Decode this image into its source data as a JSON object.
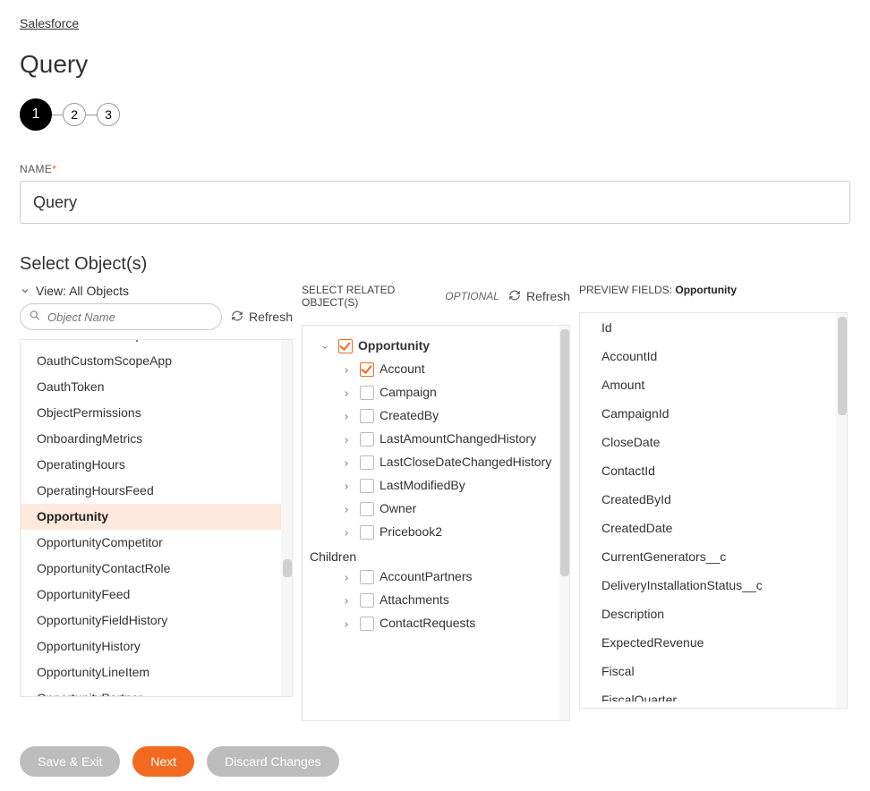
{
  "breadcrumb": "Salesforce",
  "title": "Query",
  "stepper": {
    "current": 1,
    "steps": [
      "1",
      "2",
      "3"
    ]
  },
  "form": {
    "nameLabel": "NAME",
    "nameValue": "Query"
  },
  "selectObjects": {
    "sectionTitle": "Select Object(s)",
    "viewLabel": "View: All Objects",
    "searchPlaceholder": "Object Name",
    "refreshLabel": "Refresh",
    "items": [
      {
        "label": "OauthCustomScope",
        "selected": false,
        "clippedTop": true
      },
      {
        "label": "OauthCustomScopeApp",
        "selected": false
      },
      {
        "label": "OauthToken",
        "selected": false
      },
      {
        "label": "ObjectPermissions",
        "selected": false
      },
      {
        "label": "OnboardingMetrics",
        "selected": false
      },
      {
        "label": "OperatingHours",
        "selected": false
      },
      {
        "label": "OperatingHoursFeed",
        "selected": false
      },
      {
        "label": "Opportunity",
        "selected": true
      },
      {
        "label": "OpportunityCompetitor",
        "selected": false
      },
      {
        "label": "OpportunityContactRole",
        "selected": false
      },
      {
        "label": "OpportunityFeed",
        "selected": false
      },
      {
        "label": "OpportunityFieldHistory",
        "selected": false
      },
      {
        "label": "OpportunityHistory",
        "selected": false
      },
      {
        "label": "OpportunityLineItem",
        "selected": false
      },
      {
        "label": "OpportunityPartner",
        "selected": false
      }
    ],
    "thumbTop": 245,
    "thumbHeight": 20
  },
  "related": {
    "header": "SELECT RELATED OBJECT(S)",
    "optional": "OPTIONAL",
    "refreshLabel": "Refresh",
    "root": {
      "label": "Opportunity",
      "checked": true,
      "expanded": true,
      "items": [
        {
          "label": "Account",
          "checked": true
        },
        {
          "label": "Campaign",
          "checked": false
        },
        {
          "label": "CreatedBy",
          "checked": false
        },
        {
          "label": "LastAmountChangedHistory",
          "checked": false
        },
        {
          "label": "LastCloseDateChangedHistory",
          "checked": false
        },
        {
          "label": "LastModifiedBy",
          "checked": false
        },
        {
          "label": "Owner",
          "checked": false
        },
        {
          "label": "Pricebook2",
          "checked": false
        }
      ],
      "childrenLabel": "Children",
      "children": [
        {
          "label": "AccountPartners",
          "checked": false
        },
        {
          "label": "Attachments",
          "checked": false
        },
        {
          "label": "ContactRequests",
          "checked": false
        }
      ]
    }
  },
  "preview": {
    "header": "PREVIEW FIELDS:",
    "object": "Opportunity",
    "fields": [
      "Id",
      "AccountId",
      "Amount",
      "CampaignId",
      "CloseDate",
      "ContactId",
      "CreatedById",
      "CreatedDate",
      "CurrentGenerators__c",
      "DeliveryInstallationStatus__c",
      "Description",
      "ExpectedRevenue",
      "Fiscal",
      "FiscalQuarter"
    ]
  },
  "footer": {
    "saveExit": "Save & Exit",
    "next": "Next",
    "discard": "Discard Changes"
  }
}
